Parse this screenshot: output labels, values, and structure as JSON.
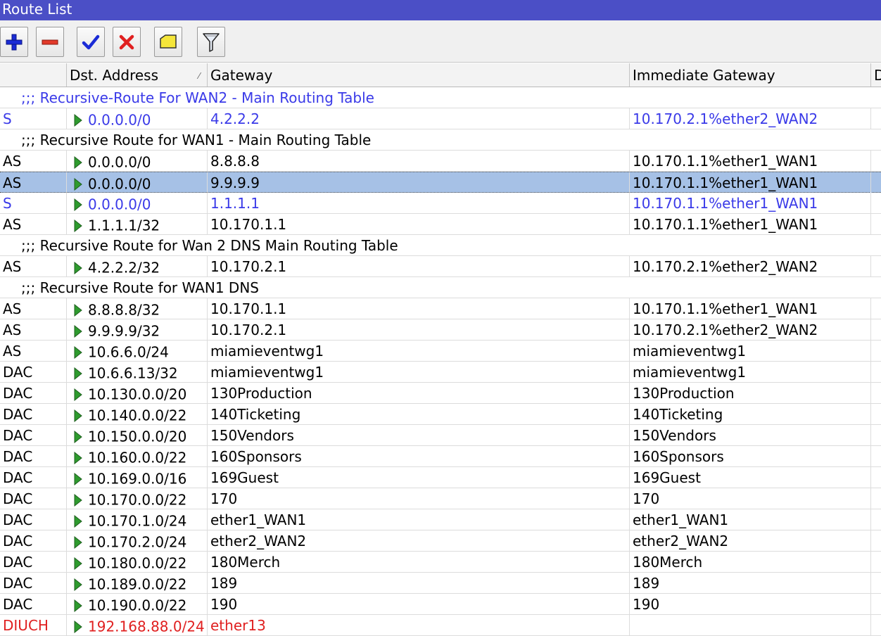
{
  "window": {
    "title": "Route List"
  },
  "toolbar": {
    "buttons": [
      {
        "name": "add-button",
        "icon": "plus-icon"
      },
      {
        "name": "remove-button",
        "icon": "minus-icon"
      },
      {
        "name": "enable-button",
        "icon": "check-icon"
      },
      {
        "name": "disable-button",
        "icon": "x-icon"
      },
      {
        "name": "comment-button",
        "icon": "note-icon"
      },
      {
        "name": "filter-button",
        "icon": "funnel-icon"
      }
    ]
  },
  "colors": {
    "blue": "#3a3ae8",
    "red": "#e02020",
    "selected": "#a6c1e6",
    "arrow": "#2e9b2e"
  },
  "table": {
    "columns": [
      "",
      "Dst. Address",
      "Gateway",
      "Immediate Gateway",
      "D"
    ],
    "sort_indicator": "⁄",
    "rows": [
      {
        "comment": ";;; Recursive-Route For WAN2 - Main Routing Table",
        "color": "blue"
      },
      {
        "flags": "S",
        "dst": "0.0.0.0/0",
        "gateway": "4.2.2.2",
        "immediate": "10.170.2.1%ether2_WAN2",
        "color": "blue"
      },
      {
        "comment": ";;; Recursive Route for WAN1 - Main Routing Table"
      },
      {
        "flags": "AS",
        "dst": "0.0.0.0/0",
        "gateway": "8.8.8.8",
        "immediate": "10.170.1.1%ether1_WAN1"
      },
      {
        "flags": "AS",
        "dst": "0.0.0.0/0",
        "gateway": "9.9.9.9",
        "immediate": "10.170.1.1%ether1_WAN1",
        "selected": true
      },
      {
        "flags": "S",
        "dst": "0.0.0.0/0",
        "gateway": "1.1.1.1",
        "immediate": "10.170.1.1%ether1_WAN1",
        "color": "blue"
      },
      {
        "flags": "AS",
        "dst": "1.1.1.1/32",
        "gateway": "10.170.1.1",
        "immediate": "10.170.1.1%ether1_WAN1"
      },
      {
        "comment": ";;; Recursive Route for Wan 2 DNS Main Routing Table"
      },
      {
        "flags": "AS",
        "dst": "4.2.2.2/32",
        "gateway": "10.170.2.1",
        "immediate": "10.170.2.1%ether2_WAN2"
      },
      {
        "comment": ";;; Recursive Route for WAN1 DNS"
      },
      {
        "flags": "AS",
        "dst": "8.8.8.8/32",
        "gateway": "10.170.1.1",
        "immediate": "10.170.1.1%ether1_WAN1"
      },
      {
        "flags": "AS",
        "dst": "9.9.9.9/32",
        "gateway": "10.170.2.1",
        "immediate": "10.170.2.1%ether2_WAN2"
      },
      {
        "flags": "AS",
        "dst": "10.6.6.0/24",
        "gateway": "miamieventwg1",
        "immediate": "miamieventwg1"
      },
      {
        "flags": "DAC",
        "dst": "10.6.6.13/32",
        "gateway": "miamieventwg1",
        "immediate": "miamieventwg1"
      },
      {
        "flags": "DAC",
        "dst": "10.130.0.0/20",
        "gateway": "130Production",
        "immediate": "130Production"
      },
      {
        "flags": "DAC",
        "dst": "10.140.0.0/22",
        "gateway": "140Ticketing",
        "immediate": "140Ticketing"
      },
      {
        "flags": "DAC",
        "dst": "10.150.0.0/20",
        "gateway": "150Vendors",
        "immediate": "150Vendors"
      },
      {
        "flags": "DAC",
        "dst": "10.160.0.0/22",
        "gateway": "160Sponsors",
        "immediate": "160Sponsors"
      },
      {
        "flags": "DAC",
        "dst": "10.169.0.0/16",
        "gateway": "169Guest",
        "immediate": "169Guest"
      },
      {
        "flags": "DAC",
        "dst": "10.170.0.0/22",
        "gateway": "170",
        "immediate": "170"
      },
      {
        "flags": "DAC",
        "dst": "10.170.1.0/24",
        "gateway": "ether1_WAN1",
        "immediate": "ether1_WAN1"
      },
      {
        "flags": "DAC",
        "dst": "10.170.2.0/24",
        "gateway": "ether2_WAN2",
        "immediate": "ether2_WAN2"
      },
      {
        "flags": "DAC",
        "dst": "10.180.0.0/22",
        "gateway": "180Merch",
        "immediate": "180Merch"
      },
      {
        "flags": "DAC",
        "dst": "10.189.0.0/22",
        "gateway": "189",
        "immediate": "189"
      },
      {
        "flags": "DAC",
        "dst": "10.190.0.0/22",
        "gateway": "190",
        "immediate": "190"
      },
      {
        "flags": "DIUCH",
        "dst": "192.168.88.0/24",
        "gateway": "ether13",
        "immediate": "",
        "color": "red"
      }
    ]
  }
}
